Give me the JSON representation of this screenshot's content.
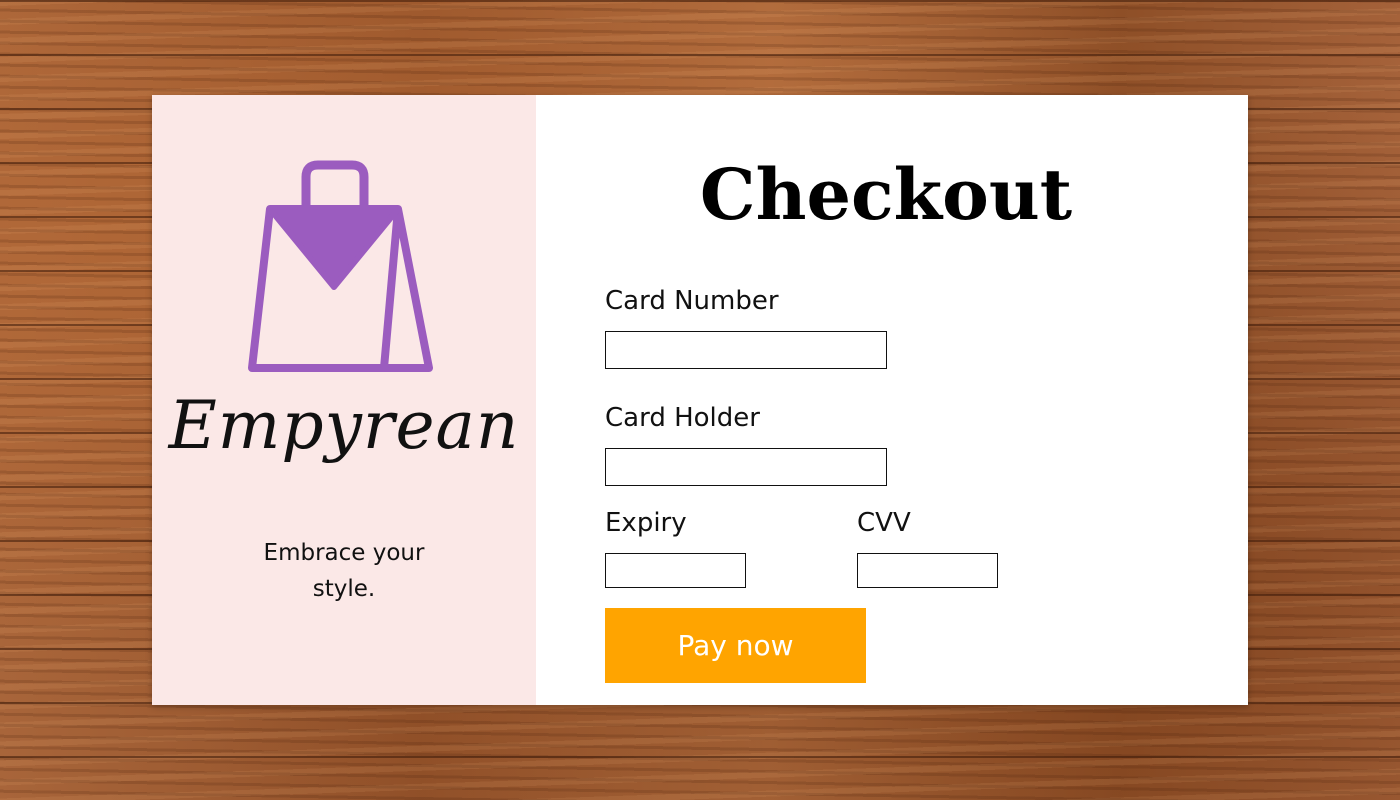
{
  "brand": {
    "icon": "shopping-bag-icon",
    "name": "Empyrean",
    "tagline": "Embrace your style.",
    "accent_color": "#9b5cbf",
    "panel_color": "#fbe8e7"
  },
  "checkout": {
    "title": "Checkout",
    "card_number": {
      "label": "Card Number",
      "value": ""
    },
    "card_holder": {
      "label": "Card Holder",
      "value": ""
    },
    "expiry": {
      "label": "Expiry",
      "value": ""
    },
    "cvv": {
      "label": "CVV",
      "value": ""
    },
    "pay_button": {
      "label": "Pay now",
      "color": "#ffa400"
    }
  }
}
